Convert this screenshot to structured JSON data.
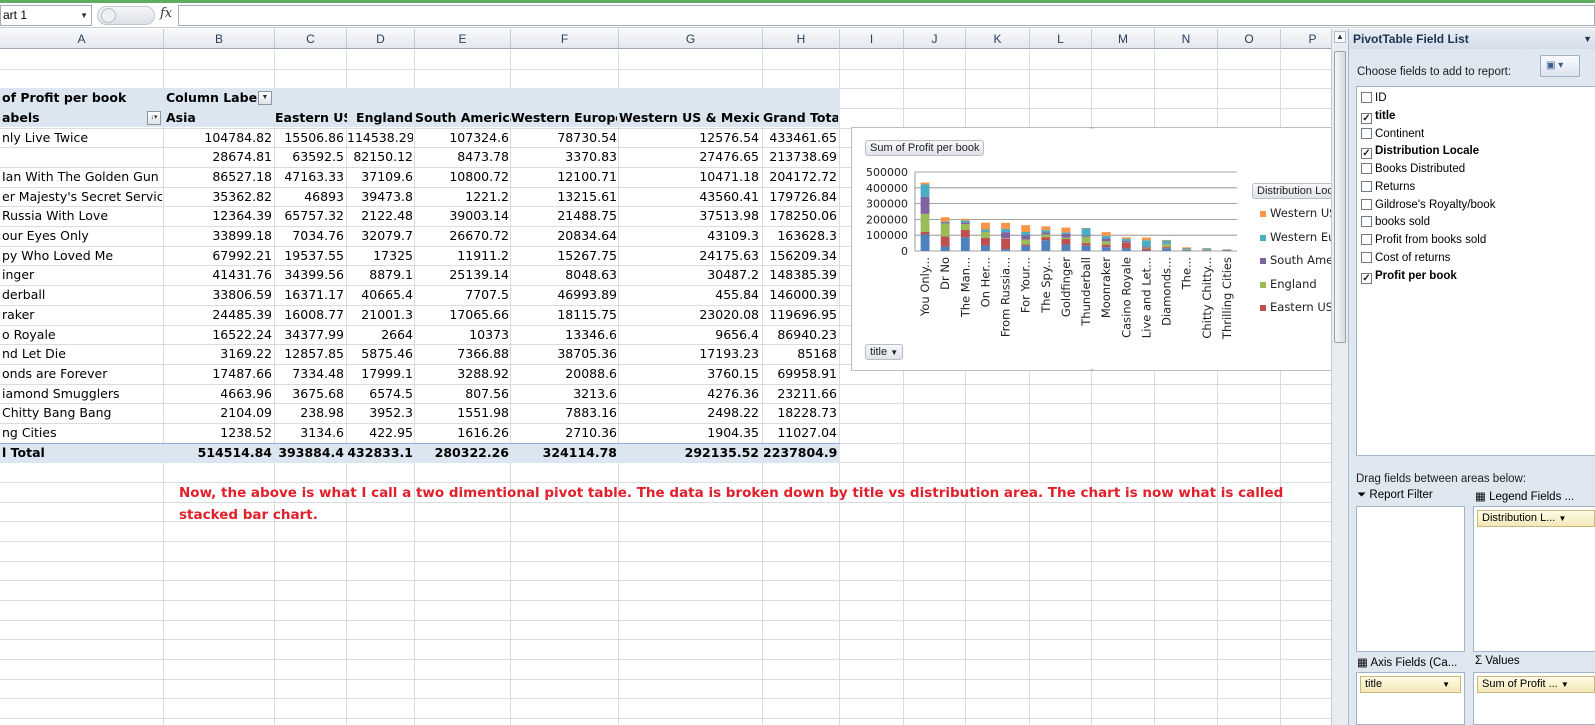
{
  "formula_bar": {
    "name_box": "art 1",
    "fx_label": "fx",
    "formula": ""
  },
  "columns": [
    "A",
    "B",
    "C",
    "D",
    "E",
    "F",
    "G",
    "H",
    "I",
    "J",
    "K",
    "L",
    "M",
    "N",
    "O",
    "P"
  ],
  "pivot": {
    "values_label": "of Profit per book",
    "column_labels": "Column Labels",
    "row_labels": "abels",
    "headers": [
      "Asia",
      "Eastern US",
      "England",
      "South America",
      "Western Europe",
      "Western US & Mexico",
      "Grand Total"
    ],
    "rows": [
      {
        "title": "nly Live Twice",
        "vals": [
          "104784.82",
          "15506.86",
          "114538.29",
          "107324.6",
          "78730.54",
          "12576.54",
          "433461.65"
        ]
      },
      {
        "title": "",
        "vals": [
          "28674.81",
          "63592.5",
          "82150.12",
          "8473.78",
          "3370.83",
          "27476.65",
          "213738.69"
        ]
      },
      {
        "title": "Ian With The Golden Gun",
        "vals": [
          "86527.18",
          "47163.33",
          "37109.6",
          "10800.72",
          "12100.71",
          "10471.18",
          "204172.72"
        ]
      },
      {
        "title": "er Majesty's Secret Service",
        "vals": [
          "35362.82",
          "46893",
          "39473.8",
          "1221.2",
          "13215.61",
          "43560.41",
          "179726.84"
        ]
      },
      {
        "title": "Russia With Love",
        "vals": [
          "12364.39",
          "65757.32",
          "2122.48",
          "39003.14",
          "21488.75",
          "37513.98",
          "178250.06"
        ]
      },
      {
        "title": "our Eyes Only",
        "vals": [
          "33899.18",
          "7034.76",
          "32079.7",
          "26670.72",
          "20834.64",
          "43109.3",
          "163628.3"
        ]
      },
      {
        "title": "py Who Loved Me",
        "vals": [
          "67992.21",
          "19537.55",
          "17325",
          "11911.2",
          "15267.75",
          "24175.63",
          "156209.34"
        ]
      },
      {
        "title": "inger",
        "vals": [
          "41431.76",
          "34399.56",
          "8879.1",
          "25139.14",
          "8048.63",
          "30487.2",
          "148385.39"
        ]
      },
      {
        "title": "derball",
        "vals": [
          "33806.59",
          "16371.17",
          "40665.4",
          "7707.5",
          "46993.89",
          "455.84",
          "146000.39"
        ]
      },
      {
        "title": "raker",
        "vals": [
          "24485.39",
          "16008.77",
          "21001.3",
          "17065.66",
          "18115.75",
          "23020.08",
          "119696.95"
        ]
      },
      {
        "title": "o Royale",
        "vals": [
          "16522.24",
          "34377.99",
          "2664",
          "10373",
          "13346.6",
          "9656.4",
          "86940.23"
        ]
      },
      {
        "title": "nd Let Die",
        "vals": [
          "3169.22",
          "12857.85",
          "5875.46",
          "7366.88",
          "38705.36",
          "17193.23",
          "85168"
        ]
      },
      {
        "title": "onds are Forever",
        "vals": [
          "17487.66",
          "7334.48",
          "17999.1",
          "3288.92",
          "20088.6",
          "3760.15",
          "69958.91"
        ]
      },
      {
        "title": "iamond Smugglers",
        "vals": [
          "4663.96",
          "3675.68",
          "6574.5",
          "807.56",
          "3213.6",
          "4276.36",
          "23211.66"
        ]
      },
      {
        "title": " Chitty Bang Bang",
        "vals": [
          "2104.09",
          "238.98",
          "3952.3",
          "1551.98",
          "7883.16",
          "2498.22",
          "18228.73"
        ]
      },
      {
        "title": "ng Cities",
        "vals": [
          "1238.52",
          "3134.6",
          "422.95",
          "1616.26",
          "2710.36",
          "1904.35",
          "11027.04"
        ]
      }
    ],
    "total": {
      "title": "l Total",
      "vals": [
        "514514.84",
        "393884.4",
        "432833.1",
        "280322.26",
        "324114.78",
        "292135.52",
        "2237804.9"
      ]
    }
  },
  "note": "Now, the above is what I call a two dimentional pivot table. The data is broken down by title vs distribution area. The chart is now what is called stacked bar chart.",
  "chart_data": {
    "type": "bar",
    "stacked": true,
    "title": "Sum of Profit per book",
    "axis_field_button": "title",
    "legend_title": "Distribution Loca",
    "categories": [
      "You Only...",
      "Dr No",
      "The Man...",
      "On Her...",
      "From Russia...",
      "For Your...",
      "The Spy...",
      "Goldfinger",
      "Thunderball",
      "Moonraker",
      "Casino Royale",
      "Live and Let...",
      "Diamonds...",
      "The...",
      "Chitty Chitty...",
      "Thrilling Cities"
    ],
    "ylim": [
      0,
      500000
    ],
    "yticks": [
      "500000",
      "400000",
      "300000",
      "200000",
      "100000",
      "0"
    ],
    "series": [
      {
        "name": "Asia",
        "color": "#4f81bd",
        "values": [
          104784.82,
          28674.81,
          86527.18,
          35362.82,
          12364.39,
          33899.18,
          67992.21,
          41431.76,
          33806.59,
          24485.39,
          16522.24,
          3169.22,
          17487.66,
          4663.96,
          2104.09,
          1238.52
        ]
      },
      {
        "name": "Eastern US",
        "color": "#c0504d",
        "values": [
          15506.86,
          63592.5,
          47163.33,
          46893,
          65757.32,
          7034.76,
          19537.55,
          34399.56,
          16371.17,
          16008.77,
          34377.99,
          12857.85,
          7334.48,
          3675.68,
          238.98,
          3134.6
        ]
      },
      {
        "name": "England",
        "color": "#9bbb59",
        "values": [
          114538.29,
          82150.12,
          37109.6,
          39473.8,
          2122.48,
          32079.7,
          17325,
          8879.1,
          40665.4,
          21001.3,
          2664,
          5875.46,
          17999.1,
          6574.5,
          3952.3,
          422.95
        ]
      },
      {
        "name": "South America",
        "color": "#8064a2",
        "values": [
          107324.6,
          8473.78,
          10800.72,
          1221.2,
          39003.14,
          26670.72,
          11911.2,
          25139.14,
          7707.5,
          17065.66,
          10373,
          7366.88,
          3288.92,
          807.56,
          1551.98,
          1616.26
        ]
      },
      {
        "name": "Western Europe",
        "color": "#4bacc6",
        "values": [
          78730.54,
          3370.83,
          12100.71,
          13215.61,
          21488.75,
          20834.64,
          15267.75,
          8048.63,
          46993.89,
          18115.75,
          13346.6,
          38705.36,
          20088.6,
          3213.6,
          7883.16,
          2710.36
        ]
      },
      {
        "name": "Western US & Mexico",
        "color": "#f79646",
        "values": [
          12576.54,
          27476.65,
          10471.18,
          43560.41,
          37513.98,
          43109.3,
          24175.63,
          30487.2,
          455.84,
          23020.08,
          9656.4,
          17193.23,
          3760.15,
          4276.36,
          2498.22,
          1904.35
        ]
      }
    ],
    "legend_visible": [
      "Western US",
      "Western Eur",
      "South Amer",
      "England",
      "Eastern US"
    ],
    "legend_colors": [
      "#f79646",
      "#4bacc6",
      "#8064a2",
      "#9bbb59",
      "#c0504d"
    ]
  },
  "field_list": {
    "title": "PivotTable Field List",
    "choose_label": "Choose fields to add to report:",
    "fields": [
      {
        "name": "ID",
        "checked": false,
        "bold": false
      },
      {
        "name": "title",
        "checked": true,
        "bold": true
      },
      {
        "name": "Continent",
        "checked": false,
        "bold": false
      },
      {
        "name": "Distribution Locale",
        "checked": true,
        "bold": true
      },
      {
        "name": "Books Distributed",
        "checked": false,
        "bold": false
      },
      {
        "name": "Returns",
        "checked": false,
        "bold": false
      },
      {
        "name": "Gildrose's Royalty/book",
        "checked": false,
        "bold": false
      },
      {
        "name": "books sold",
        "checked": false,
        "bold": false
      },
      {
        "name": "Profit from books sold",
        "checked": false,
        "bold": false
      },
      {
        "name": "Cost of returns",
        "checked": false,
        "bold": false
      },
      {
        "name": "Profit per book",
        "checked": true,
        "bold": true
      }
    ],
    "drag_label": "Drag fields between areas below:",
    "report_filter_label": "Report Filter",
    "legend_fields_label": "Legend Fields ...",
    "legend_field_value": "Distribution L...",
    "axis_fields_label": "Axis Fields (Ca...",
    "values_label": "Values",
    "axis_field_value": "title",
    "values_field_value": "Sum of Profit ..."
  }
}
